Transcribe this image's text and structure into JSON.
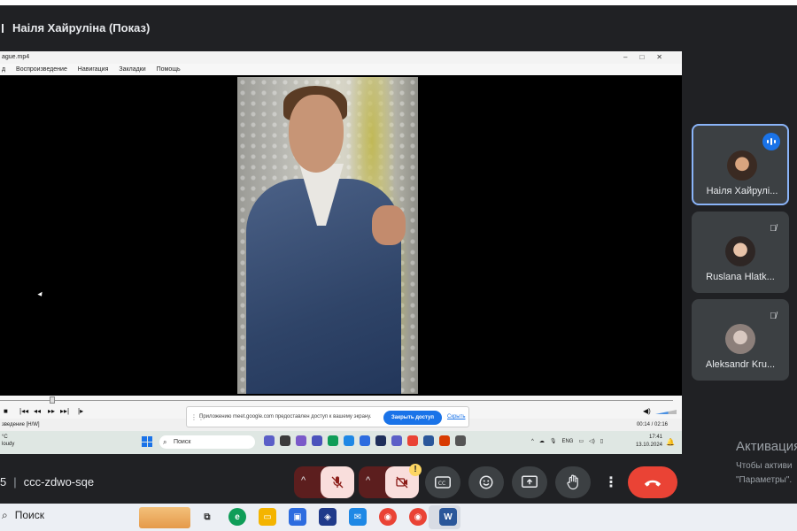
{
  "presenter_title": "Наіля Хайруліна (Показ)",
  "player": {
    "file_title": "ague.mp4",
    "menu": [
      "д",
      "Воспроизведение",
      "Навигация",
      "Закладки",
      "Помощь"
    ],
    "status_left": "зведение [H/W]",
    "time": "00:14 / 02:16"
  },
  "share_notice": {
    "message": "Приложению meet.google.com предоставлен доступ к вашему экрану.",
    "stop_label": "Закрыть доступ",
    "hide_label": "Скрыть"
  },
  "inner_taskbar": {
    "weather_temp": "°C",
    "weather_desc": "loudy",
    "search_placeholder": "Поиск",
    "lang": "ENG",
    "clock_time": "17:41",
    "clock_date": "13.10.2024"
  },
  "participants": [
    {
      "name": "Наіля Хайрулі...",
      "status": "speaking"
    },
    {
      "name": "Ruslana Hlatk...",
      "status": "muted"
    },
    {
      "name": "Aleksandr Kru...",
      "status": "muted"
    }
  ],
  "activation": {
    "title": "Активация",
    "line1": "Чтобы активи",
    "line2": "\"Параметры\"."
  },
  "meeting": {
    "time_fragment": "5",
    "code": "ccc-zdwo-sqe"
  },
  "outer_taskbar": {
    "search_label": "Поиск"
  },
  "colors": {
    "background": "#202124",
    "tile": "#3c4043",
    "muted_button": "#5c1e1e",
    "hangup": "#ea4335",
    "accent": "#1a73e8",
    "warning": "#fdd663"
  }
}
